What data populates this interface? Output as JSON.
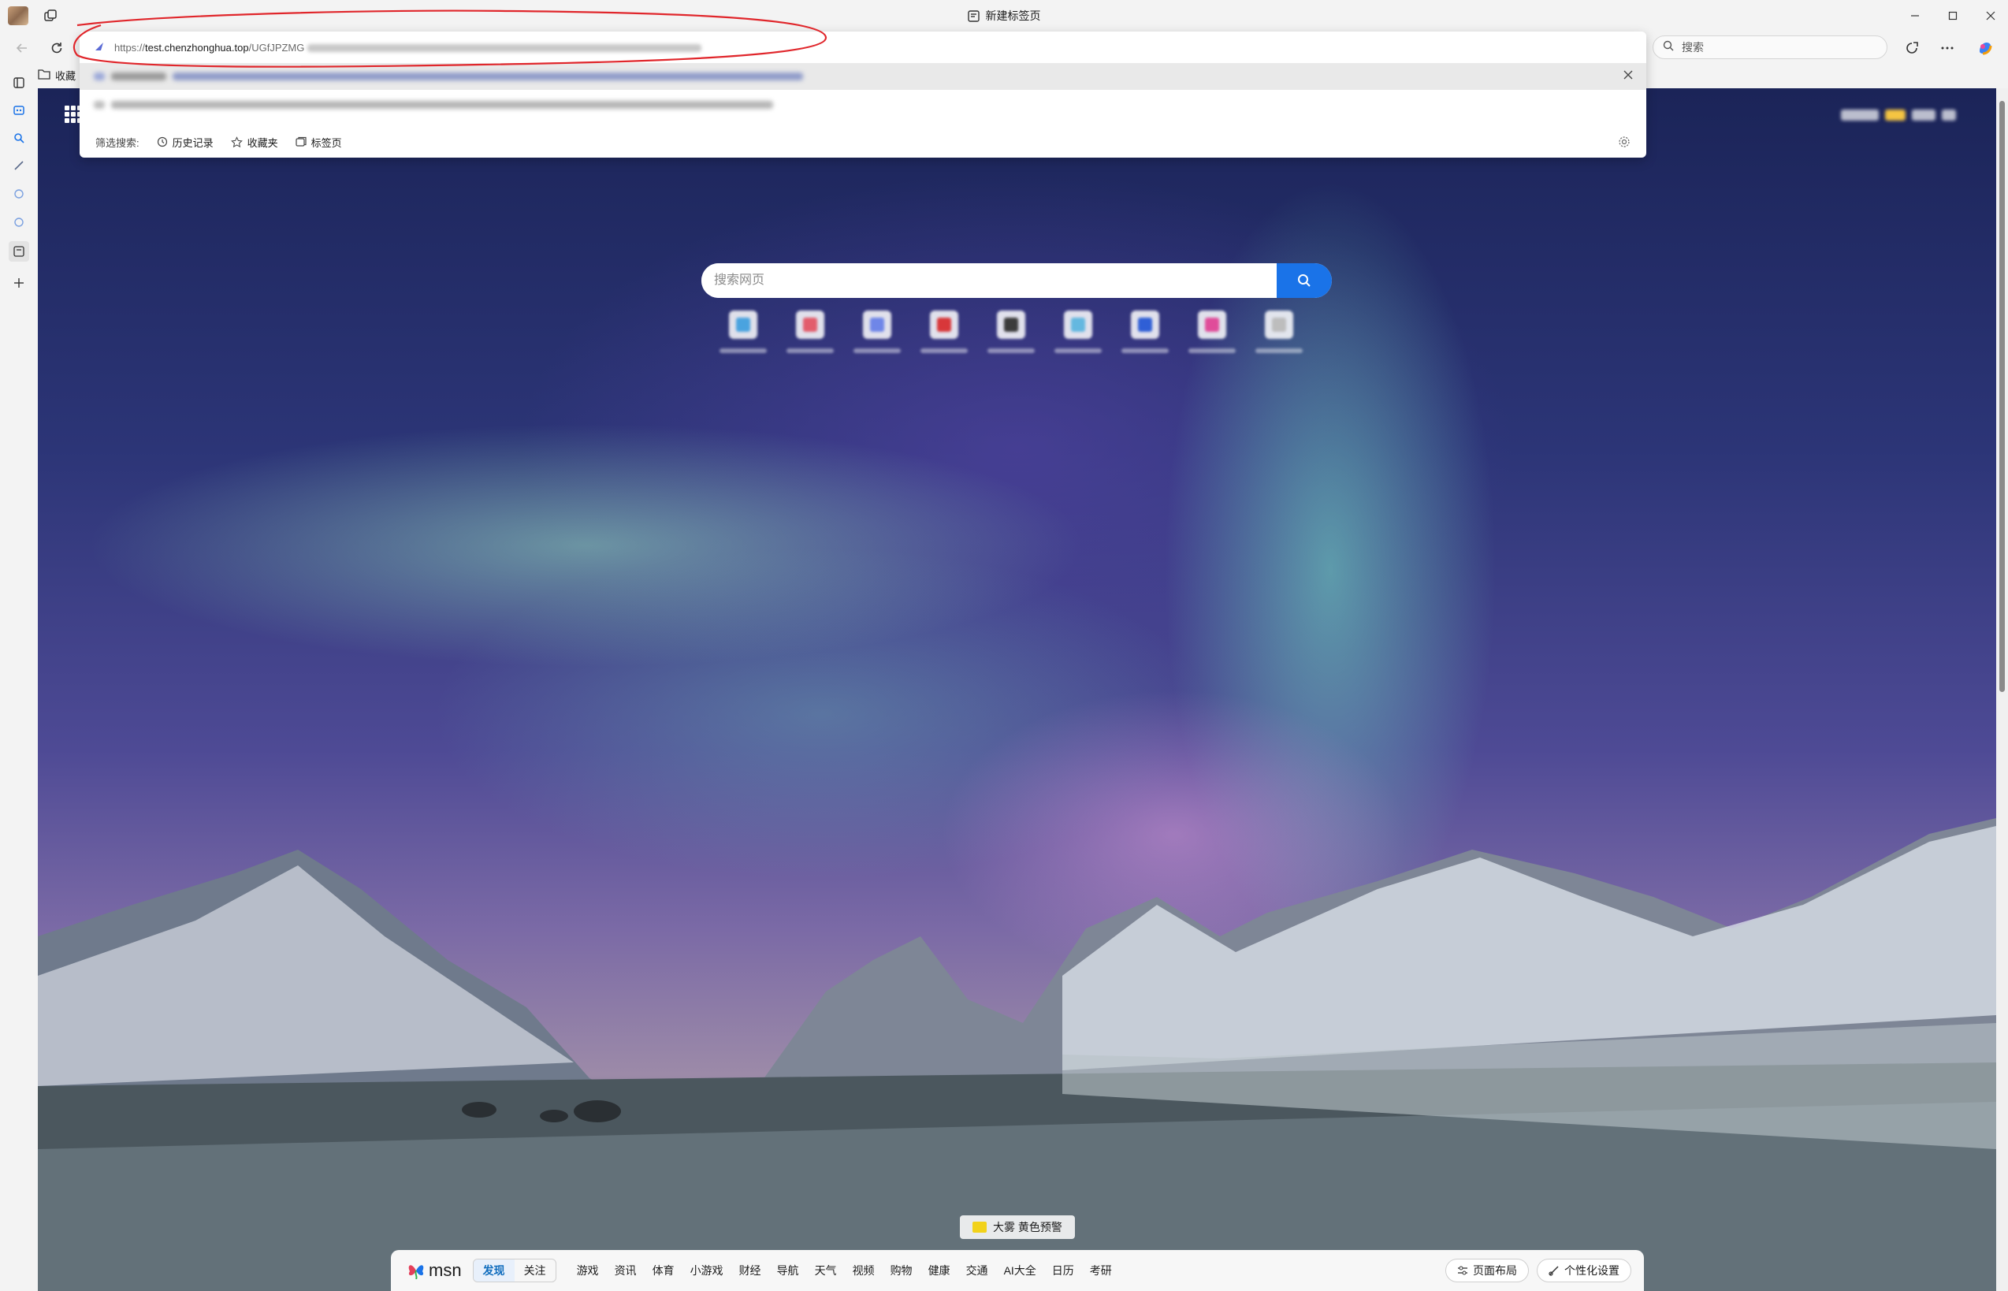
{
  "window": {
    "tab_title": "新建标签页"
  },
  "omnibox": {
    "url_prefix": "https://",
    "url_host": "test.chenzhonghua.top",
    "url_path": "/UGfJPZMG",
    "filter_label": "筛选搜索:",
    "filters": [
      {
        "label": "历史记录",
        "icon": "history-icon"
      },
      {
        "label": "收藏夹",
        "icon": "star-icon"
      },
      {
        "label": "标签页",
        "icon": "tabs-icon"
      }
    ]
  },
  "side_search": {
    "placeholder": "搜索"
  },
  "favorites_bar": {
    "folder_label": "收藏"
  },
  "ntp": {
    "search_placeholder": "搜索网页",
    "alert": "大雾 黄色预警",
    "quicklink_colors": [
      "#4aa3df",
      "#e25c6b",
      "#6f86e8",
      "#d8373a",
      "#3b3b3b",
      "#64b8e0",
      "#2f5fd6",
      "#e04c9a",
      "#bdbdbd"
    ]
  },
  "msn": {
    "logo_text": "msn",
    "segments": [
      "发现",
      "关注"
    ],
    "nav": [
      "游戏",
      "资讯",
      "体育",
      "小游戏",
      "财经",
      "导航",
      "天气",
      "视频",
      "购物",
      "健康",
      "交通",
      "AI大全",
      "日历",
      "考研"
    ],
    "layout_button": "页面布局",
    "personalize_button": "个性化设置"
  },
  "colors": {
    "accent": "#1a73e8",
    "annotation": "#e0262b"
  }
}
